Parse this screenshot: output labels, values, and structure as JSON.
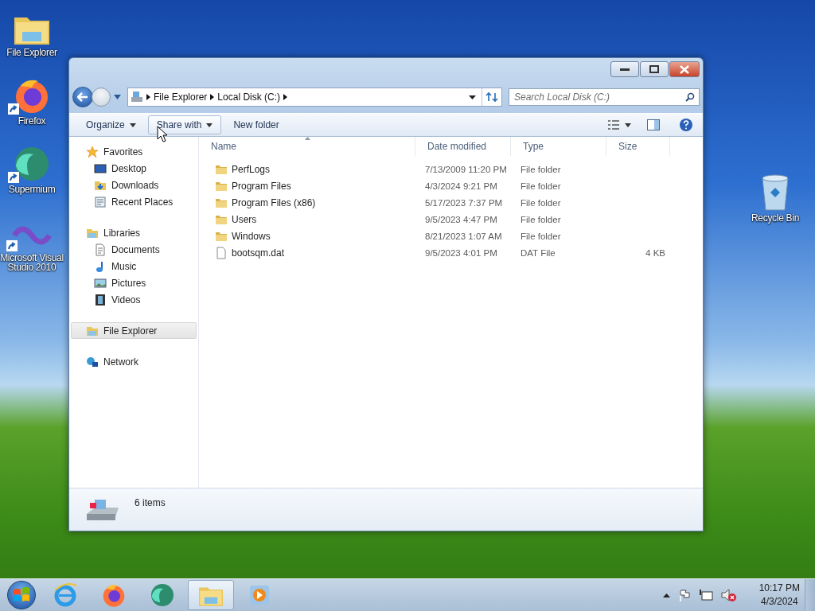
{
  "desktop_icons": {
    "left": [
      {
        "label": "File Explorer",
        "kind": "explorer",
        "shortcut": false
      },
      {
        "label": "Firefox",
        "kind": "firefox",
        "shortcut": true
      },
      {
        "label": "Supermium",
        "kind": "supermium",
        "shortcut": true
      },
      {
        "label": "Microsoft Visual Studio 2010",
        "kind": "visualstudio",
        "shortcut": true
      }
    ],
    "right": [
      {
        "label": "Recycle Bin",
        "kind": "recyclebin",
        "shortcut": false
      }
    ]
  },
  "window": {
    "breadcrumb": [
      "File Explorer",
      "Local Disk (C:)"
    ],
    "search": {
      "placeholder": "Search Local Disk (C:)"
    },
    "toolbar": [
      {
        "label": "Organize",
        "dropdown": true,
        "hovered": false
      },
      {
        "label": "Share with",
        "dropdown": true,
        "hovered": true
      },
      {
        "label": "New folder",
        "dropdown": false,
        "hovered": false
      }
    ],
    "navigation": [
      {
        "label": "Favorites",
        "kind": "star",
        "selected": false,
        "children": [
          {
            "label": "Desktop",
            "kind": "desktop",
            "selected": false
          },
          {
            "label": "Downloads",
            "kind": "downloads",
            "selected": false
          },
          {
            "label": "Recent Places",
            "kind": "recent",
            "selected": false
          }
        ]
      },
      {
        "label": "Libraries",
        "kind": "library",
        "selected": false,
        "children": [
          {
            "label": "Documents",
            "kind": "documents",
            "selected": false
          },
          {
            "label": "Music",
            "kind": "music",
            "selected": false
          },
          {
            "label": "Pictures",
            "kind": "pictures",
            "selected": false
          },
          {
            "label": "Videos",
            "kind": "videos",
            "selected": false
          }
        ]
      },
      {
        "label": "File Explorer",
        "kind": "library",
        "selected": true
      },
      {
        "label": "Network",
        "kind": "network",
        "selected": false
      }
    ],
    "columns": [
      {
        "label": "Name",
        "sorted": true
      },
      {
        "label": "Date modified",
        "sorted": false
      },
      {
        "label": "Type",
        "sorted": false
      },
      {
        "label": "Size",
        "sorted": false
      }
    ],
    "rows": [
      {
        "name": "PerfLogs",
        "kind": "folder",
        "date": "7/13/2009 11:20 PM",
        "type": "File folder"
      },
      {
        "name": "Program Files",
        "kind": "folder",
        "date": "4/3/2024 9:21 PM",
        "type": "File folder"
      },
      {
        "name": "Program Files (x86)",
        "kind": "folder",
        "date": "5/17/2023 7:37 PM",
        "type": "File folder"
      },
      {
        "name": "Users",
        "kind": "folder",
        "date": "9/5/2023 4:47 PM",
        "type": "File folder"
      },
      {
        "name": "Windows",
        "kind": "folder",
        "date": "8/21/2023 1:07 AM",
        "type": "File folder"
      },
      {
        "name": "bootsqm.dat",
        "kind": "file",
        "date": "9/5/2023 4:01 PM",
        "type": "DAT File",
        "size": "4 KB"
      }
    ],
    "status": "6 items"
  },
  "taskbar": {
    "pinned": [
      {
        "kind": "ie",
        "active": false
      },
      {
        "kind": "firefox",
        "active": false
      },
      {
        "kind": "supermium",
        "active": false
      },
      {
        "kind": "explorer",
        "active": true
      },
      {
        "kind": "mediaplayer",
        "active": false
      }
    ],
    "time": "10:17 PM",
    "date": "4/3/2024"
  }
}
